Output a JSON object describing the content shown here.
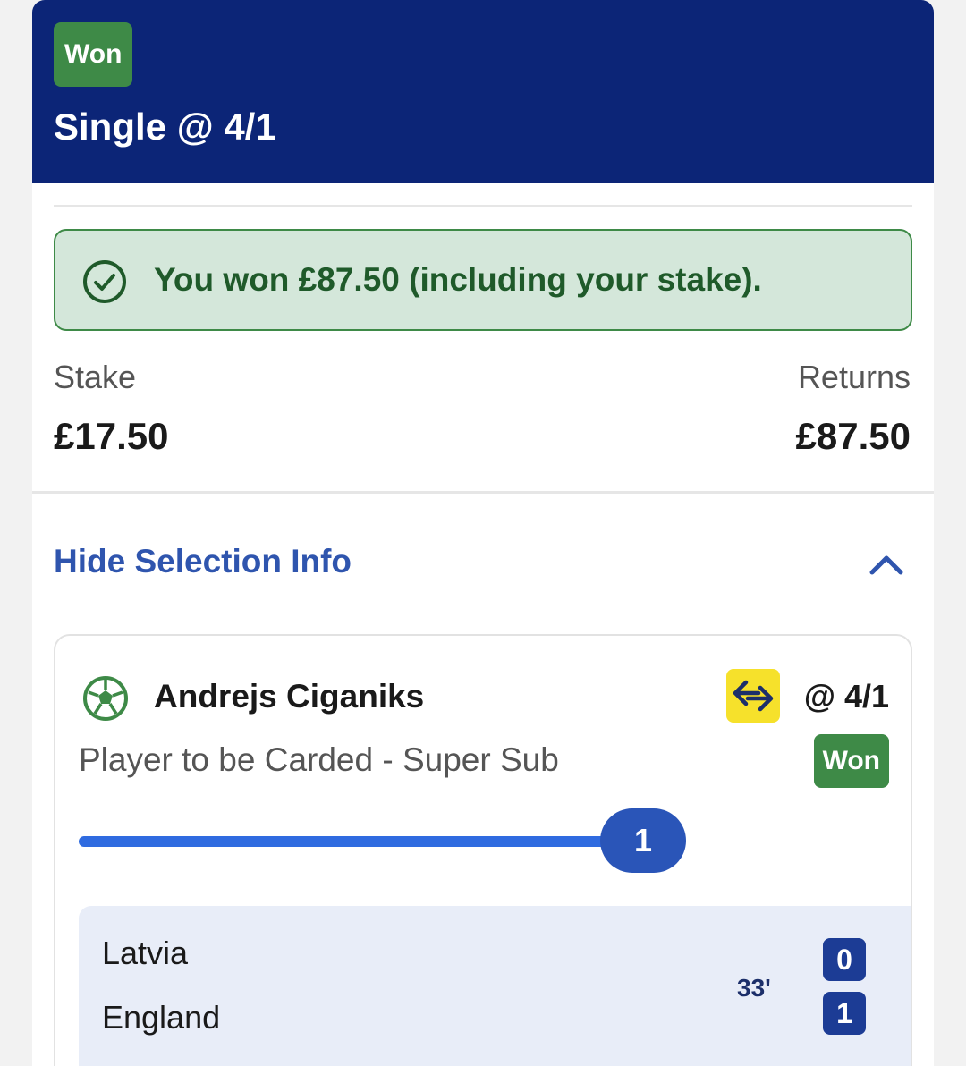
{
  "bet": {
    "status_badge": "Won",
    "title": "Single @ 4/1",
    "win_message": "You won £87.50 (including your stake).",
    "stake_label": "Stake",
    "stake_value": "£17.50",
    "returns_label": "Returns",
    "returns_value": "£87.50",
    "toggle_label": "Hide Selection Info"
  },
  "selection": {
    "player": "Andrejs Ciganiks",
    "odds": "@ 4/1",
    "market": "Player to be Carded - Super Sub",
    "status_badge": "Won",
    "progress_value": "1",
    "icons": [
      "football-icon",
      "super-sub-swap-icon",
      "check-circle-icon",
      "chevron-up-icon"
    ]
  },
  "match": {
    "home_team": "Latvia",
    "away_team": "England",
    "time": "33'",
    "home_score": "0",
    "away_score": "1"
  },
  "colors": {
    "header_bg": "#0c2577",
    "won_green": "#3e8a47",
    "alert_bg": "#d4e7da",
    "link_blue": "#2f55ae",
    "progress_blue": "#2f6be0",
    "super_sub_yellow": "#f6e12b",
    "scoreboard_bg": "#e8edf8"
  }
}
